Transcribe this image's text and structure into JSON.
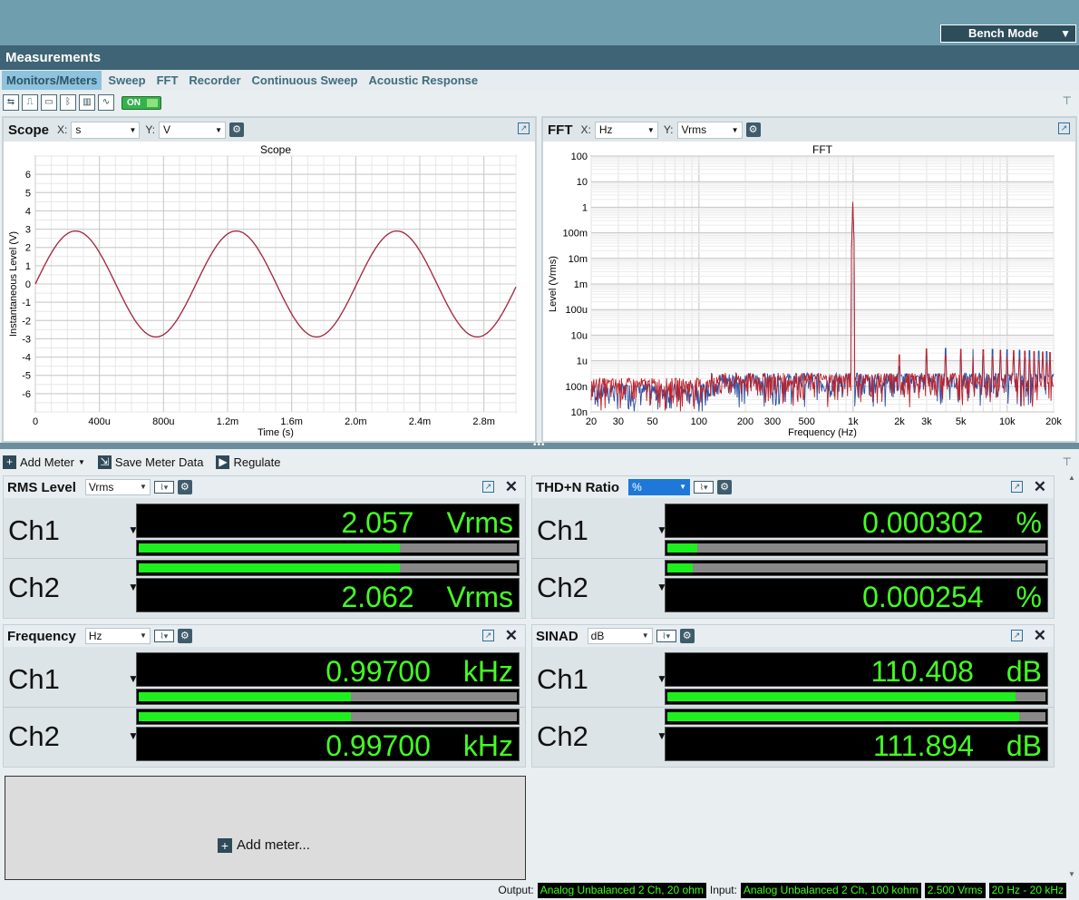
{
  "header": {
    "mode_button": "Bench Mode",
    "section_title": "Measurements"
  },
  "tabs": [
    "Monitors/Meters",
    "Sweep",
    "FFT",
    "Recorder",
    "Continuous Sweep",
    "Acoustic Response"
  ],
  "toolbar": {
    "on_label": "ON"
  },
  "scope": {
    "panel_title": "Scope",
    "x_label": "X:",
    "x_unit": "s",
    "y_label": "Y:",
    "y_unit": "V",
    "chart_data": {
      "type": "line",
      "title": "Scope",
      "xlabel": "Time (s)",
      "ylabel": "Instantaneous Level (V)",
      "xlim": [
        0,
        0.003
      ],
      "ylim": [
        -7,
        7
      ],
      "x_tick_labels": [
        "0",
        "400u",
        "800u",
        "1.2m",
        "1.6m",
        "2.0m",
        "2.4m",
        "2.8m"
      ],
      "y_tick_labels": [
        "6",
        "5",
        "4",
        "3",
        "2",
        "1",
        "0",
        "-1",
        "-2",
        "-3",
        "-4",
        "-5",
        "-6"
      ],
      "series": [
        {
          "name": "Ch1",
          "amplitude": 2.9,
          "frequency_hz": 997,
          "color": "#2a4fa0"
        },
        {
          "name": "Ch2",
          "amplitude": 2.9,
          "frequency_hz": 997,
          "color": "#c0202a"
        }
      ]
    }
  },
  "fft": {
    "panel_title": "FFT",
    "x_label": "X:",
    "x_unit": "Hz",
    "y_label": "Y:",
    "y_unit": "Vrms",
    "chart_data": {
      "type": "line",
      "title": "FFT",
      "xlabel": "Frequency (Hz)",
      "ylabel": "Level (Vrms)",
      "xscale": "log",
      "yscale": "log",
      "xlim": [
        20,
        20000
      ],
      "ylim": [
        1e-08,
        100
      ],
      "x_tick_labels": [
        "20",
        "30",
        "50",
        "100",
        "200",
        "300",
        "500",
        "1k",
        "2k",
        "3k",
        "5k",
        "10k",
        "20k"
      ],
      "y_tick_labels": [
        "100",
        "10",
        "1",
        "100m",
        "10m",
        "1m",
        "100u",
        "10u",
        "1u",
        "100n",
        "10n"
      ],
      "fundamental": {
        "frequency_hz": 997,
        "level_vrms": 2.06
      },
      "harmonics_hz": [
        2000,
        3000,
        4000,
        5000,
        6000,
        7000,
        8000,
        9000,
        10000,
        11000,
        12000,
        13000,
        14000,
        15000,
        16000,
        17000,
        18000,
        19000
      ],
      "noise_floor_vrms": 1e-07,
      "series": [
        {
          "name": "Ch1",
          "color": "#2a4fa0"
        },
        {
          "name": "Ch2",
          "color": "#c0202a"
        }
      ]
    }
  },
  "meterbar": {
    "add_meter": "Add Meter",
    "save_meter": "Save Meter Data",
    "regulate": "Regulate"
  },
  "meters": {
    "rms": {
      "title": "RMS Level",
      "unit_select": "Vrms",
      "ch1": {
        "label": "Ch1",
        "value": "2.057",
        "unit": "Vrms",
        "bar_fraction": 0.69
      },
      "ch2": {
        "label": "Ch2",
        "value": "2.062",
        "unit": "Vrms",
        "bar_fraction": 0.69
      }
    },
    "thdn": {
      "title": "THD+N Ratio",
      "unit_select": "%",
      "ch1": {
        "label": "Ch1",
        "value": "0.000302",
        "unit": "%",
        "bar_fraction": 0.08
      },
      "ch2": {
        "label": "Ch2",
        "value": "0.000254",
        "unit": "%",
        "bar_fraction": 0.066
      }
    },
    "freq": {
      "title": "Frequency",
      "unit_select": "Hz",
      "ch1": {
        "label": "Ch1",
        "value": "0.99700",
        "unit": "kHz",
        "bar_fraction": 0.56
      },
      "ch2": {
        "label": "Ch2",
        "value": "0.99700",
        "unit": "kHz",
        "bar_fraction": 0.56
      }
    },
    "sinad": {
      "title": "SINAD",
      "unit_select": "dB",
      "ch1": {
        "label": "Ch1",
        "value": "110.408",
        "unit": "dB",
        "bar_fraction": 0.92
      },
      "ch2": {
        "label": "Ch2",
        "value": "111.894",
        "unit": "dB",
        "bar_fraction": 0.93
      }
    }
  },
  "add_meter_placeholder": "Add meter...",
  "status": {
    "output_label": "Output:",
    "output_value": "Analog Unbalanced 2 Ch, 20 ohm",
    "input_label": "Input:",
    "input_value": "Analog Unbalanced 2 Ch, 100 kohm",
    "level": "2.500 Vrms",
    "bandwidth": "20 Hz - 20 kHz"
  },
  "colors": {
    "meter_text": "#44ff22",
    "bar_fill": "#1df01d",
    "ch1_trace": "#2a4fa0",
    "ch2_trace": "#c0202a"
  }
}
